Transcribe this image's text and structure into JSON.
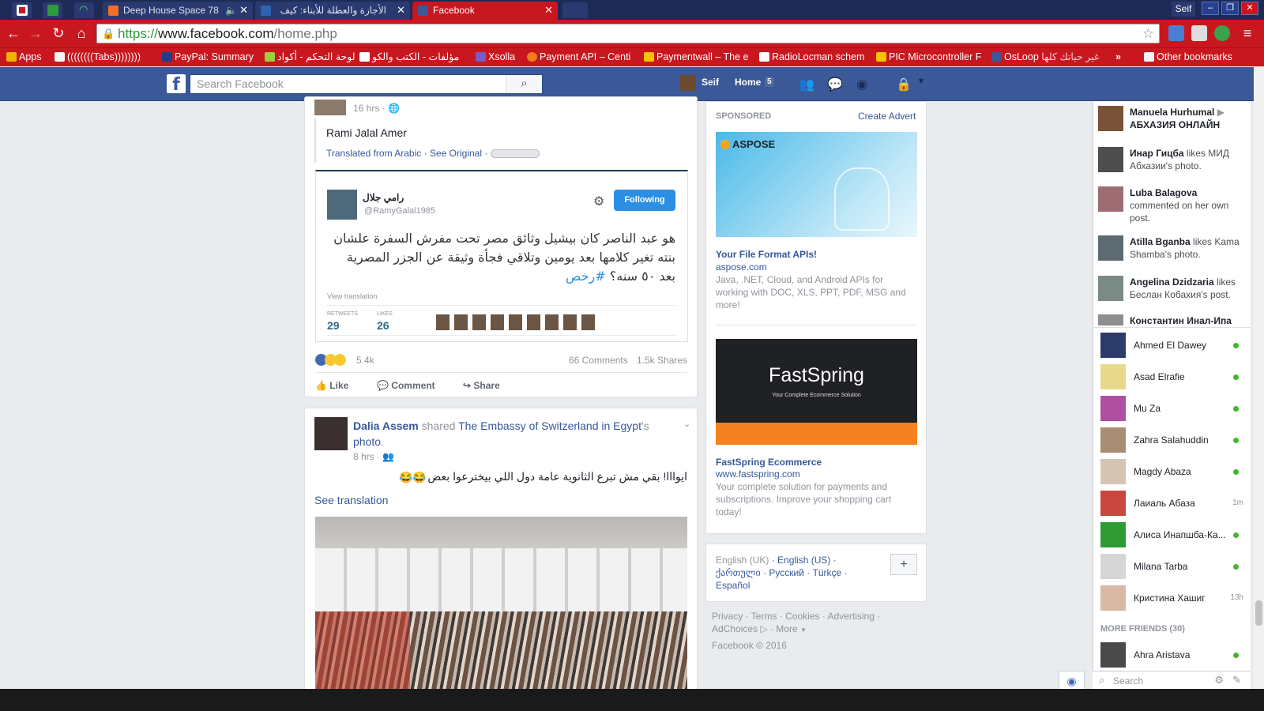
{
  "browser": {
    "tabs": [
      {
        "title": "Deep House Space 78",
        "icon": "soundcloud-icon"
      },
      {
        "title": "الأجازة والعطلة للأبناء: كيف",
        "icon": "news-icon"
      },
      {
        "title": "Facebook",
        "icon": "facebook-icon"
      }
    ],
    "user": "Seif",
    "window_buttons": [
      "–",
      "❐",
      "✕"
    ],
    "url_scheme": "https://",
    "url_host": "www.facebook.com",
    "url_path": "/home.php",
    "bookmarks": [
      "Apps",
      "((((((((Tabs))))))))",
      "PayPal: Summary",
      "لوحة التحكم - أكواد",
      "مؤلفات - الكتب والكو",
      "Xsolla",
      "Payment API – Centi",
      "Paymentwall – The e",
      "RadioLocman schem",
      "PIC Microcontroller F",
      "OsLoop",
      "غير حياتك كلها",
      "Other bookmarks"
    ],
    "colors": {
      "chrome": "#c8171e",
      "tabstrip": "#1d2a56"
    }
  },
  "fb": {
    "logo": "f",
    "search_placeholder": "Search Facebook",
    "profile_name": "Seif",
    "home_label": "Home",
    "home_count": "5",
    "brand_color": "#3b5998"
  },
  "post1": {
    "time": "16 hrs",
    "text": "Rami Jalal Amer",
    "translated": "Translated from Arabic",
    "see_original": "See Original",
    "tweet": {
      "name": "رامي جلال",
      "handle": "@RamyGalal1985",
      "follow": "Following",
      "line1": "هو عبد الناصر كان بيشيل وثائق مصر تحت مفرش السفرة علشان",
      "line2": "بنته تغير كلامها بعد يومين وتلاقي فجأة وثيقة عن الجزر المصرية",
      "line3": "بعد ٥٠ سنه؟",
      "hashtag": "#رخص",
      "view_translation": "View translation",
      "retweets_label": "RETWEETS",
      "retweets": "29",
      "likes_label": "LIKES",
      "likes": "26"
    },
    "reactions": "5.4k",
    "comments": "66 Comments",
    "shares": "1.5k Shares",
    "actions": [
      "Like",
      "Comment",
      "Share"
    ]
  },
  "post2": {
    "author": "Dalia Assem",
    "shared": "shared",
    "page": "The Embassy of Switzerland in Egypt",
    "possessive": "'s",
    "photo": "photo",
    "time": "8 hrs",
    "text": "ايوااا! بقي مش تبرع الثانوية عامة دول اللي بيخترعوا بعض",
    "see_translation": "See translation"
  },
  "sponsored": {
    "heading": "SPONSORED",
    "create": "Create Advert",
    "ads": [
      {
        "brand": "ASPOSE",
        "title": "Your File Format APIs!",
        "domain": "aspose.com",
        "desc": "Java, .NET, Cloud, and Android APIs for working with DOC, XLS, PPT, PDF, MSG and more!"
      },
      {
        "brand": "FastSpring",
        "tagline": "Your Complete Ecommerce Solution",
        "title": "FastSpring Ecommerce",
        "domain": "www.fastspring.com",
        "desc": "Your complete solution for payments and subscriptions. Improve your shopping cart today!"
      }
    ]
  },
  "languages": {
    "current": "English (UK)",
    "others": [
      "English (US)",
      "ქართული",
      "Русский",
      "Türkçe",
      "Español"
    ],
    "add": "+"
  },
  "footer": {
    "links": [
      "Privacy",
      "Terms",
      "Cookies",
      "Advertising",
      "AdChoices",
      "More"
    ],
    "copyright": "Facebook © 2016"
  },
  "ticker": [
    {
      "name": "Manuela Hurhumal",
      "text": "АБХАЗИЯ ОНЛАЙН",
      "bold_text": true
    },
    {
      "name": "Инар Гицба",
      "text": "likes МИД Абхазии's photo."
    },
    {
      "name": "Luba Balagova",
      "text": "commented on her own post."
    },
    {
      "name": "Atilla Bganba",
      "text": "likes Kama Shamba's photo."
    },
    {
      "name": "Angelina Dzidzaria",
      "text": "likes Беслан Кобахия's post."
    },
    {
      "name": "Константин Инал-Ипа",
      "text": ""
    }
  ],
  "chat": {
    "friends": [
      {
        "name": "Ahmed El Dawey",
        "status": "online"
      },
      {
        "name": "Asad Elrafie",
        "status": "online"
      },
      {
        "name": "Mu Za",
        "status": "online"
      },
      {
        "name": "Zahra Salahuddin",
        "status": "online"
      },
      {
        "name": "Magdy Abaza",
        "status": "online"
      },
      {
        "name": "Лаиаль Абаза",
        "status": "1m"
      },
      {
        "name": "Алиса Инапшба-Ка...",
        "status": "online"
      },
      {
        "name": "Milana Tarba",
        "status": "online"
      },
      {
        "name": "Кристина Хашиг",
        "status": "13h"
      }
    ],
    "more_friends": "MORE FRIENDS (30)",
    "more": [
      {
        "name": "Ahra Aristava",
        "status": "online"
      }
    ],
    "search_placeholder": "Search"
  }
}
